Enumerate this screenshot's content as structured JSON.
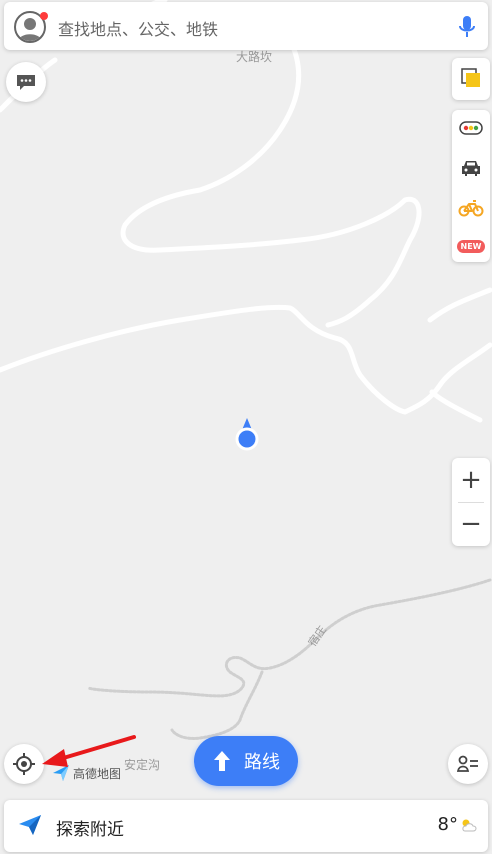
{
  "search": {
    "placeholder": "查找地点、公交、地铁"
  },
  "map": {
    "labels": {
      "top_place": "大路坎",
      "road": "宿庄",
      "village": "安定沟"
    }
  },
  "tools": {
    "layers_icon": "layers-icon",
    "traffic_icon": "traffic-light-icon",
    "taxi_icon": "taxi-icon",
    "bike_icon": "bike-icon",
    "new_badge": "NEW"
  },
  "zoom": {
    "in": "+",
    "out": "−"
  },
  "route_button": {
    "label": "路线"
  },
  "logo": {
    "text": "高德地图"
  },
  "bottom": {
    "explore": "探索附近",
    "temperature": "8°"
  },
  "colors": {
    "accent": "#3d7ef7",
    "notify": "#ff3b3b",
    "annotation_arrow": "#e8191b"
  }
}
